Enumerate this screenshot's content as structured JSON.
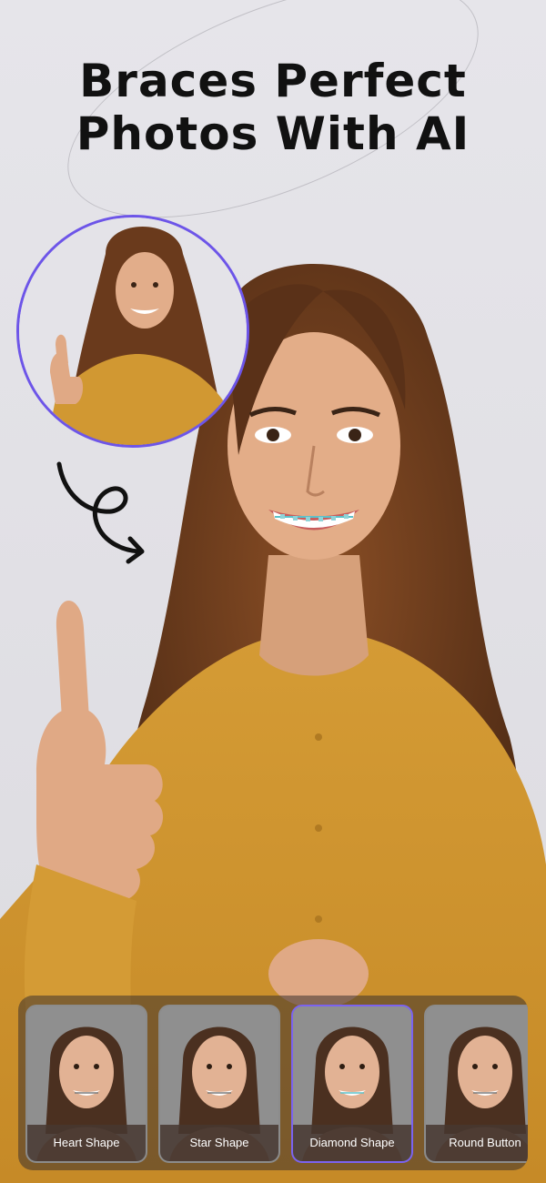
{
  "headline": {
    "line1": "Braces Perfect",
    "line2": "Photos With AI"
  },
  "colors": {
    "accent": "#6d55e8",
    "headline_text": "#111111",
    "tray_background": "#3c322d",
    "card_label_text": "#ffffff"
  },
  "before_image": {
    "description_icon": "before-photo"
  },
  "after_image": {
    "description_icon": "after-photo-with-braces"
  },
  "arrow": {
    "icon": "loop-arrow-icon"
  },
  "styles": {
    "selected": "Diamond Shape",
    "items": [
      {
        "label": "Heart Shape"
      },
      {
        "label": "Star Shape"
      },
      {
        "label": "Diamond Shape"
      },
      {
        "label": "Round Button"
      }
    ]
  }
}
